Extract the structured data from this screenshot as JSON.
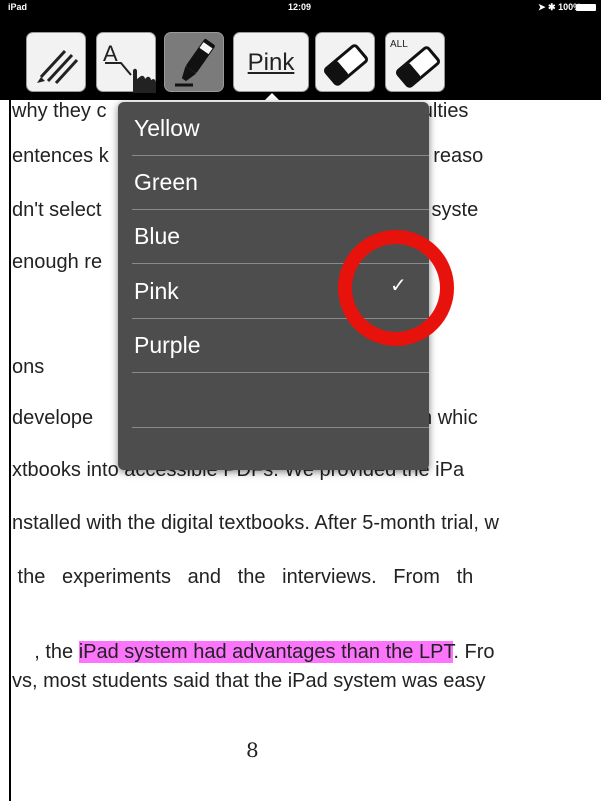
{
  "status_bar": {
    "device": "iPad",
    "time": "12:09",
    "battery": "100%"
  },
  "toolbar": {
    "tools": [
      {
        "name": "pencil-tool",
        "icon": "pencils-icon"
      },
      {
        "name": "text-select-tool",
        "icon": "hand-pointer-icon"
      },
      {
        "name": "highlighter-tool",
        "icon": "highlighter-icon",
        "active": true
      },
      {
        "name": "color-picker",
        "label": "Pink"
      },
      {
        "name": "eraser-tool",
        "icon": "eraser-icon"
      },
      {
        "name": "erase-all-tool",
        "icon": "eraser-all-icon",
        "badge": "ALL"
      }
    ]
  },
  "color_menu": {
    "items": [
      {
        "label": "Yellow"
      },
      {
        "label": "Green"
      },
      {
        "label": "Blue"
      },
      {
        "label": "Pink",
        "selected": true
      },
      {
        "label": "Purple"
      },
      {
        "label": ""
      }
    ],
    "selected_check": "✓",
    "annotation_color": "#e8120c"
  },
  "document": {
    "lines": [
      {
        "text": "why they c                                          was difficulties"
      },
      {
        "text": "entences k                                          to Art, the reaso"
      },
      {
        "text": "dn't select                                         or the iPad syste"
      },
      {
        "text": "enough re"
      },
      {
        "text": ""
      },
      {
        "text": "ons"
      },
      {
        "text": "develope                                          sion system whic"
      },
      {
        "text": "xtbooks into accessible PDFs. We provided the iPa"
      },
      {
        "text": "nstalled with the digital textbooks. After 5-month trial, w"
      },
      {
        "text": " the   experiments   and   the   interviews.   From   th"
      },
      {
        "pre": ", the ",
        "highlight": "iPad system had advantages than the LPT",
        "post": ". Fro"
      },
      {
        "text": "vs, most students said that the iPad system was easy"
      }
    ],
    "highlight_color": "#fc74fc",
    "page_number": "8"
  }
}
